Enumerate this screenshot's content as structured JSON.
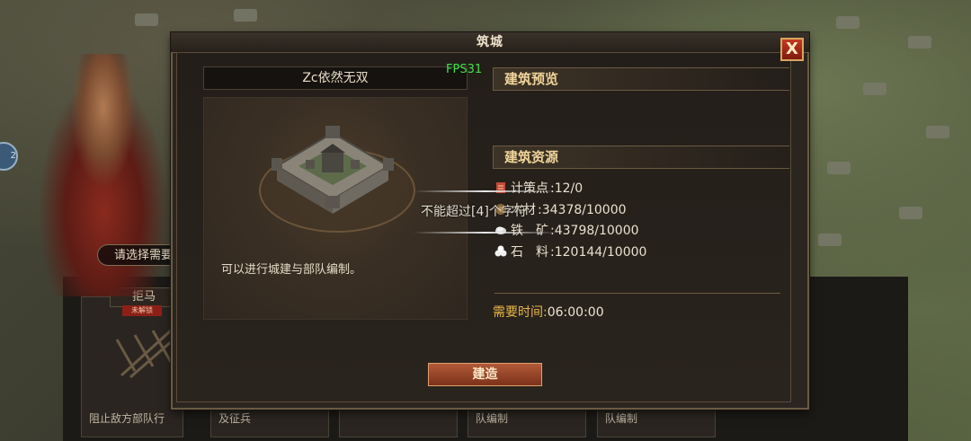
{
  "dialog": {
    "title": "筑城",
    "close_label": "X",
    "city_name": "Zc依然无双",
    "fps": "FPS31",
    "description": "可以进行城建与部队编制。",
    "preview_header": "建筑预览",
    "resources_header": "建筑资源",
    "resources": [
      {
        "icon": "strategy-point-icon",
        "label": "计策点",
        "value": ":12/0"
      },
      {
        "icon": "wood-icon",
        "label": "木材",
        "value": ":34378/10000"
      },
      {
        "icon": "iron-icon",
        "label": "铁　矿",
        "value": ":43798/10000"
      },
      {
        "icon": "stone-icon",
        "label": "石　料",
        "value": ":120144/10000"
      }
    ],
    "tooltip": "不能超过[4]个字符",
    "time_label": "需要时间:",
    "time_value": "06:00:00",
    "build_label": "建造"
  },
  "background": {
    "prompt_text": "请选择需要",
    "card_title": "拒马",
    "card_badge": "未解锁",
    "card_texts": [
      "阻止敌方部队行",
      "及征兵",
      "",
      "队编制",
      "队编制"
    ]
  },
  "colors": {
    "accent_gold": "#f0d49a",
    "time_label": "#e8b646",
    "fps": "#3fe24a",
    "build_button": "#b25a3a"
  }
}
